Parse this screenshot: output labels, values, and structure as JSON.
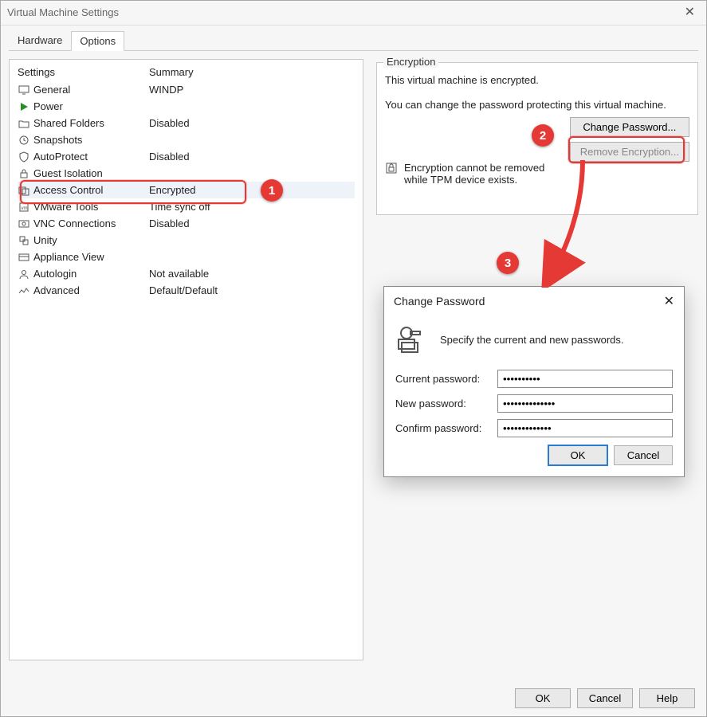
{
  "window": {
    "title": "Virtual Machine Settings"
  },
  "tabs": {
    "hardware": "Hardware",
    "options": "Options"
  },
  "columns": {
    "c1": "Settings",
    "c2": "Summary"
  },
  "settings": [
    {
      "name": "General",
      "summary": "WINDP",
      "icon": "display-icon"
    },
    {
      "name": "Power",
      "summary": "",
      "icon": "play-icon"
    },
    {
      "name": "Shared Folders",
      "summary": "Disabled",
      "icon": "folder-icon"
    },
    {
      "name": "Snapshots",
      "summary": "",
      "icon": "clock-icon"
    },
    {
      "name": "AutoProtect",
      "summary": "Disabled",
      "icon": "shield-icon"
    },
    {
      "name": "Guest Isolation",
      "summary": "",
      "icon": "lock-icon"
    },
    {
      "name": "Access Control",
      "summary": "Encrypted",
      "icon": "access-icon"
    },
    {
      "name": "VMware Tools",
      "summary": "Time sync off",
      "icon": "tools-icon"
    },
    {
      "name": "VNC Connections",
      "summary": "Disabled",
      "icon": "vnc-icon"
    },
    {
      "name": "Unity",
      "summary": "",
      "icon": "unity-icon"
    },
    {
      "name": "Appliance View",
      "summary": "",
      "icon": "appliance-icon"
    },
    {
      "name": "Autologin",
      "summary": "Not available",
      "icon": "user-icon"
    },
    {
      "name": "Advanced",
      "summary": "Default/Default",
      "icon": "advanced-icon"
    }
  ],
  "encryption": {
    "legend": "Encryption",
    "line1": "This virtual machine is encrypted.",
    "line2": "You can change the password protecting this virtual machine.",
    "changeBtn": "Change Password...",
    "removeBtn": "Remove Encryption...",
    "warn": "Encryption cannot be removed while TPM device exists."
  },
  "dialog": {
    "title": "Change Password",
    "hint": "Specify the current and new passwords.",
    "current": "Current password:",
    "newp": "New password:",
    "confirm": "Confirm password:",
    "currentVal": "••••••••••",
    "newVal": "••••••••••••••",
    "confirmVal": "•••••••••••••",
    "ok": "OK",
    "cancel": "Cancel"
  },
  "footer": {
    "ok": "OK",
    "cancel": "Cancel",
    "help": "Help"
  },
  "callouts": {
    "c1": "1",
    "c2": "2",
    "c3": "3"
  }
}
